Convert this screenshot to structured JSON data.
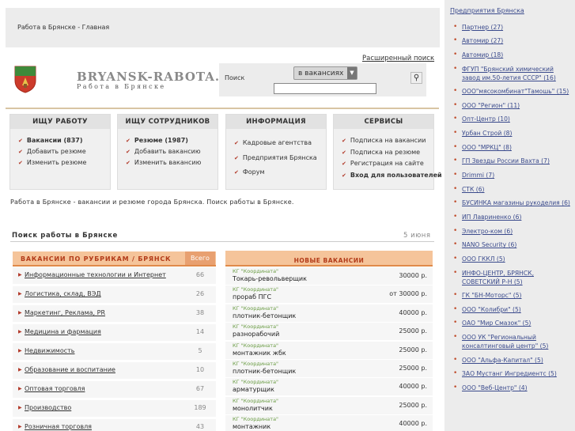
{
  "breadcrumb": "Работа в Брянске - Главная",
  "logo": {
    "title": "BRYANSK-RABOTA.RU",
    "subtitle": "Работа в Брянске"
  },
  "search": {
    "advanced_link": "Расширенный поиск",
    "label": "Поиск",
    "scope": "в вакансиях",
    "query": "",
    "button_icon": "magnifier-icon"
  },
  "menus": [
    {
      "title": "ИЩУ РАБОТУ",
      "items": [
        {
          "label": "Вакансии (837)",
          "bold": true
        },
        {
          "label": "Добавить резюме",
          "bold": false
        },
        {
          "label": "Изменить резюме",
          "bold": false
        }
      ]
    },
    {
      "title": "ИЩУ СОТРУДНИКОВ",
      "items": [
        {
          "label": "Резюме (1987)",
          "bold": true
        },
        {
          "label": "Добавить вакансию",
          "bold": false
        },
        {
          "label": "Изменить вакансию",
          "bold": false
        }
      ]
    },
    {
      "title": "ИНФОРМАЦИЯ",
      "items": [
        {
          "label": "Кадровые агентства",
          "bold": false
        },
        {
          "label": "Предприятия Брянска",
          "bold": false
        },
        {
          "label": "Форум",
          "bold": false
        }
      ]
    },
    {
      "title": "СЕРВИСЫ",
      "items": [
        {
          "label": "Подписка на вакансии",
          "bold": false
        },
        {
          "label": "Подписка на резюме",
          "bold": false
        },
        {
          "label": "Регистрация на сайте",
          "bold": false
        },
        {
          "label": "Вход для пользователей",
          "bold": true
        }
      ]
    }
  ],
  "tagline": "Работа в Брянске - вакансии и резюме города Брянска. Поиск работы в Брянске.",
  "section": {
    "title": "Поиск работы в Брянске",
    "date": "5 июня"
  },
  "categories": {
    "header": "ВАКАНСИИ ПО РУБРИКАМ / БРЯНСК",
    "total_label": "Всего",
    "rows": [
      {
        "name": "Информационные технологии и Интернет",
        "count": "66"
      },
      {
        "name": "Логистика, склад, ВЭД",
        "count": "26"
      },
      {
        "name": "Маркетинг, Реклама, PR",
        "count": "38"
      },
      {
        "name": "Медицина и фармация",
        "count": "14"
      },
      {
        "name": "Недвижимость",
        "count": "5"
      },
      {
        "name": "Образование и воспитание",
        "count": "10"
      },
      {
        "name": "Оптовая торговля",
        "count": "67"
      },
      {
        "name": "Производство",
        "count": "189"
      },
      {
        "name": "Розничная торговля",
        "count": "43"
      }
    ]
  },
  "jobs": {
    "header": "НОВЫЕ ВАКАНСИИ",
    "rows": [
      {
        "company": "КГ \"Координата\"",
        "title": "Токарь-револьверщик",
        "price": "30000 р."
      },
      {
        "company": "КГ \"Координата\"",
        "title": "прораб ПГС",
        "price": "от 30000 р."
      },
      {
        "company": "КГ \"Координата\"",
        "title": "плотник-бетонщик",
        "price": "40000 р."
      },
      {
        "company": "КГ \"Координата\"",
        "title": "разнорабочий",
        "price": "25000 р."
      },
      {
        "company": "КГ \"Координата\"",
        "title": "монтажник жбк",
        "price": "25000 р."
      },
      {
        "company": "КГ \"Координата\"",
        "title": "плотник-бетонщик",
        "price": "25000 р."
      },
      {
        "company": "КГ \"Координата\"",
        "title": "арматурщик",
        "price": "40000 р."
      },
      {
        "company": "КГ \"Координата\"",
        "title": "монолитчик",
        "price": "25000 р."
      },
      {
        "company": "КГ \"Координата\"",
        "title": "монтажник",
        "price": "40000 р."
      }
    ]
  },
  "sidebar": {
    "title": "Предприятия Брянска",
    "items": [
      "Партнер (27)",
      "Автомир (27)",
      "Автомир (18)",
      "ФГУП \"Брянский химический завод им.50-летия СССР\" (16)",
      "ООО\"мясокомбинат\"Тамошь\" (15)",
      "ООО \"Регион\" (11)",
      "Опт-Центр (10)",
      "Урбан Строй (8)",
      "ООО \"МРКЦ\" (8)",
      "ГП Звезды России Вахта (7)",
      "Drimmi (7)",
      "СТК (6)",
      "БУСИНКА магазины рукоделия (6)",
      "ИП Лавриненко (6)",
      "Электро-ком (6)",
      "NANO Security (6)",
      "ООО ГККЛ (5)",
      "ИНФО-ЦЕНТР, БРЯНСК, СОВЕТСКИЙ Р-Н (5)",
      "ГК \"БН-Моторс\" (5)",
      "ООО \"Колибри\" (5)",
      "ОАО \"Мир Смазок\" (5)",
      "ООО УК \"Региональный консалтинговый центр\" (5)",
      "ООО \"Альфа-Капитал\" (5)",
      "ЗАО Мустанг Ингредиентс (5)",
      "ООО \"Веб-Центр\" (4)"
    ]
  },
  "colors": {
    "accent": "#b33b19",
    "header_bg": "#f5c49a",
    "link": "#3a4a8c",
    "company": "#6a9c44"
  }
}
